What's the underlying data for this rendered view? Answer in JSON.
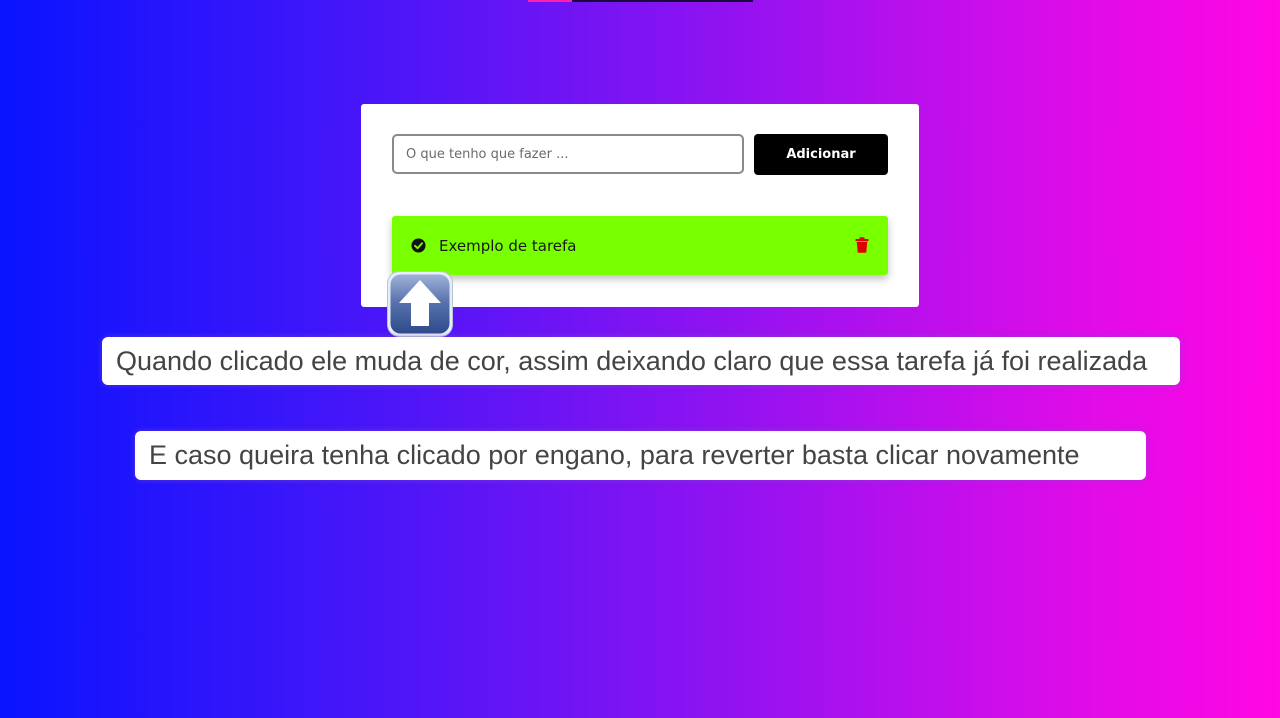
{
  "todo": {
    "input_placeholder": "O que tenho que fazer ...",
    "input_value": "",
    "add_button_label": "Adicionar",
    "tasks": [
      {
        "label": "Exemplo de tarefa",
        "completed": true,
        "status_color": "#78ff00",
        "check_icon": "check-circle-icon",
        "delete_icon": "trash-icon"
      }
    ]
  },
  "overlay": {
    "pointer_icon": "up-arrow-emoji",
    "caption_1": "Quando clicado ele muda de cor, assim deixando claro que essa tarefa já foi realizada",
    "caption_2": "E caso queira tenha clicado por engano, para reverter basta clicar novamente"
  },
  "colors": {
    "background_start": "#0a14ff",
    "background_end": "#ff06e4",
    "completed_task": "#78ff00",
    "delete_icon": "#e00000",
    "button_background": "#000000"
  }
}
